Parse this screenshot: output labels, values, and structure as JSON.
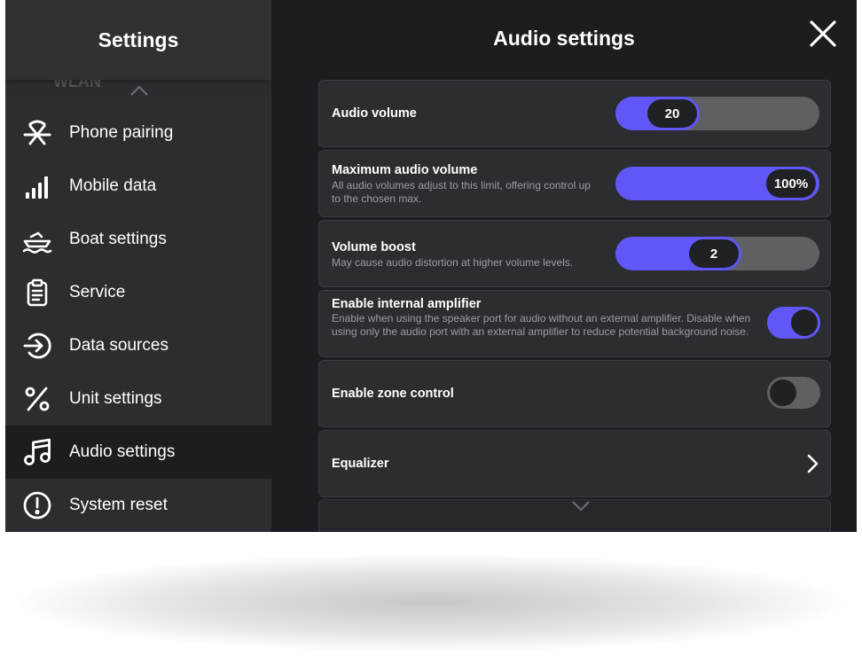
{
  "sidebar": {
    "title": "Settings",
    "ghost_item_label": "WLAN",
    "items": [
      {
        "label": "Phone pairing",
        "icon": "phone-pairing-icon"
      },
      {
        "label": "Mobile data",
        "icon": "signal-bars-icon"
      },
      {
        "label": "Boat settings",
        "icon": "boat-icon"
      },
      {
        "label": "Service",
        "icon": "clipboard-icon"
      },
      {
        "label": "Data sources",
        "icon": "data-source-arrow-icon"
      },
      {
        "label": "Unit settings",
        "icon": "percent-icon"
      },
      {
        "label": "Audio settings",
        "icon": "music-note-icon",
        "active": true
      },
      {
        "label": "System reset",
        "icon": "alert-circle-icon"
      }
    ]
  },
  "main": {
    "title": "Audio settings",
    "audio_volume": {
      "label": "Audio volume",
      "value": "20",
      "fraction": 0.2
    },
    "max_audio_volume": {
      "label": "Maximum audio volume",
      "description": "All audio volumes adjust to this limit, offering control up to the chosen max.",
      "value": "100%",
      "fraction": 1.0
    },
    "volume_boost": {
      "label": "Volume boost",
      "description": "May cause audio distortion at higher volume levels.",
      "value": "2",
      "fraction": 0.5
    },
    "internal_amplifier": {
      "label": "Enable internal amplifier",
      "description": "Enable when using the speaker port for audio without an external amplifier. Disable when using only the audio port with an external amplifier to reduce potential background noise.",
      "enabled": true
    },
    "zone_control": {
      "label": "Enable zone control",
      "enabled": false
    },
    "equalizer": {
      "label": "Equalizer"
    }
  },
  "colors": {
    "accent": "#6157f6",
    "track": "#5e6064",
    "panel": "#2b2d31",
    "background": "#1b1d20"
  }
}
